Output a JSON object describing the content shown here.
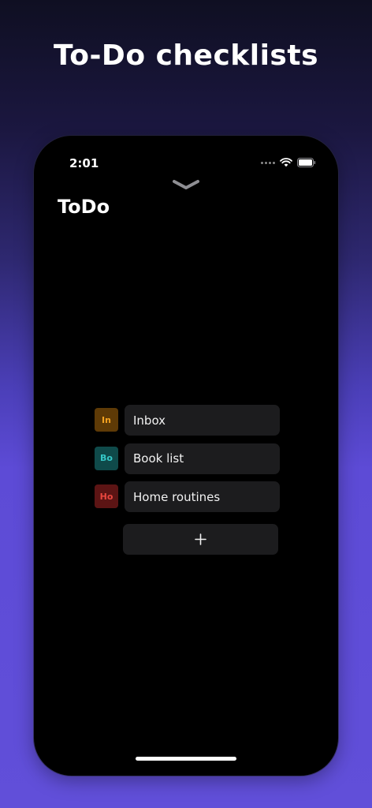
{
  "headline": "To-Do checklists",
  "status_bar": {
    "time": "2:01"
  },
  "app": {
    "title": "ToDo"
  },
  "lists": [
    {
      "badge": "In",
      "label": "Inbox",
      "badge_bg": "#5e3a06",
      "badge_fg": "#f3a221"
    },
    {
      "badge": "Bo",
      "label": "Book list",
      "badge_bg": "#0f4a4a",
      "badge_fg": "#35c8c8"
    },
    {
      "badge": "Ho",
      "label": "Home routines",
      "badge_bg": "#5c1414",
      "badge_fg": "#e8473f"
    }
  ],
  "add_button_icon": "plus-icon",
  "colors": {
    "card_bg": "#1c1c1e",
    "screen_bg": "#000000",
    "background_accent": "#614fd9"
  }
}
